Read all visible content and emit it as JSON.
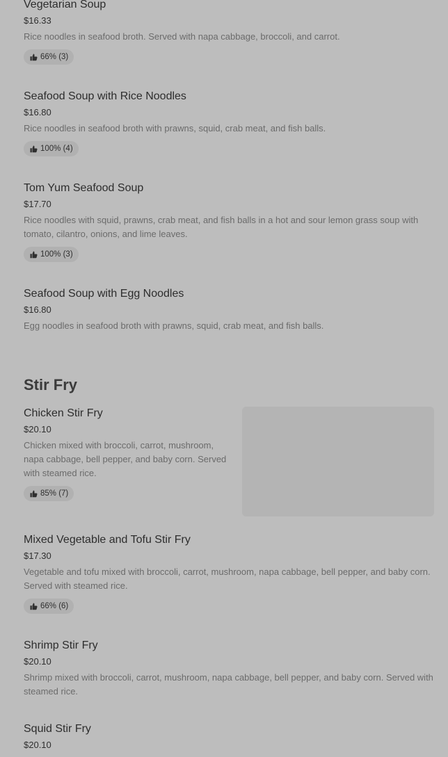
{
  "menu": {
    "items_top": [
      {
        "name": "Vegetarian Soup",
        "price": "$16.33",
        "description": "Rice noodles in seafood broth. Served with napa cabbage, broccoli, and carrot.",
        "rating": "66% (3)"
      },
      {
        "name": "Seafood Soup with Rice Noodles",
        "price": "$16.80",
        "description": "Rice noodles in seafood broth with prawns, squid, crab meat, and fish balls.",
        "rating": "100% (4)"
      },
      {
        "name": "Tom Yum Seafood Soup",
        "price": "$17.70",
        "description": "Rice noodles with squid, prawns, crab meat, and fish balls in a hot and sour lemon grass soup with tomato, cilantro, onions, and lime leaves.",
        "rating": "100% (3)"
      },
      {
        "name": "Seafood Soup with Egg Noodles",
        "price": "$16.80",
        "description": "Egg noodles in seafood broth with prawns, squid, crab meat, and fish balls."
      }
    ],
    "section_stir_fry": {
      "title": "Stir Fry",
      "items": [
        {
          "name": "Chicken Stir Fry",
          "price": "$20.10",
          "description": "Chicken mixed with broccoli, carrot, mushroom, napa cabbage, bell pepper, and baby corn. Served with steamed rice.",
          "rating": "85% (7)"
        },
        {
          "name": "Mixed Vegetable and Tofu Stir Fry",
          "price": "$17.30",
          "description": "Vegetable and tofu mixed with broccoli, carrot, mushroom, napa cabbage, bell pepper, and baby corn. Served with steamed rice.",
          "rating": "66% (6)"
        },
        {
          "name": "Shrimp Stir Fry",
          "price": "$20.10",
          "description": "Shrimp mixed with broccoli, carrot, mushroom, napa cabbage, bell pepper, and baby corn. Served with steamed rice."
        },
        {
          "name": "Squid Stir Fry",
          "price": "$20.10"
        }
      ]
    }
  },
  "icons": {
    "rating": "thumbs-up-icon"
  },
  "colors": {
    "background": "#bdbdbd",
    "chip": "#b1b1b1",
    "text": "#2d2d2d",
    "muted_text": "#6b6b6b"
  }
}
